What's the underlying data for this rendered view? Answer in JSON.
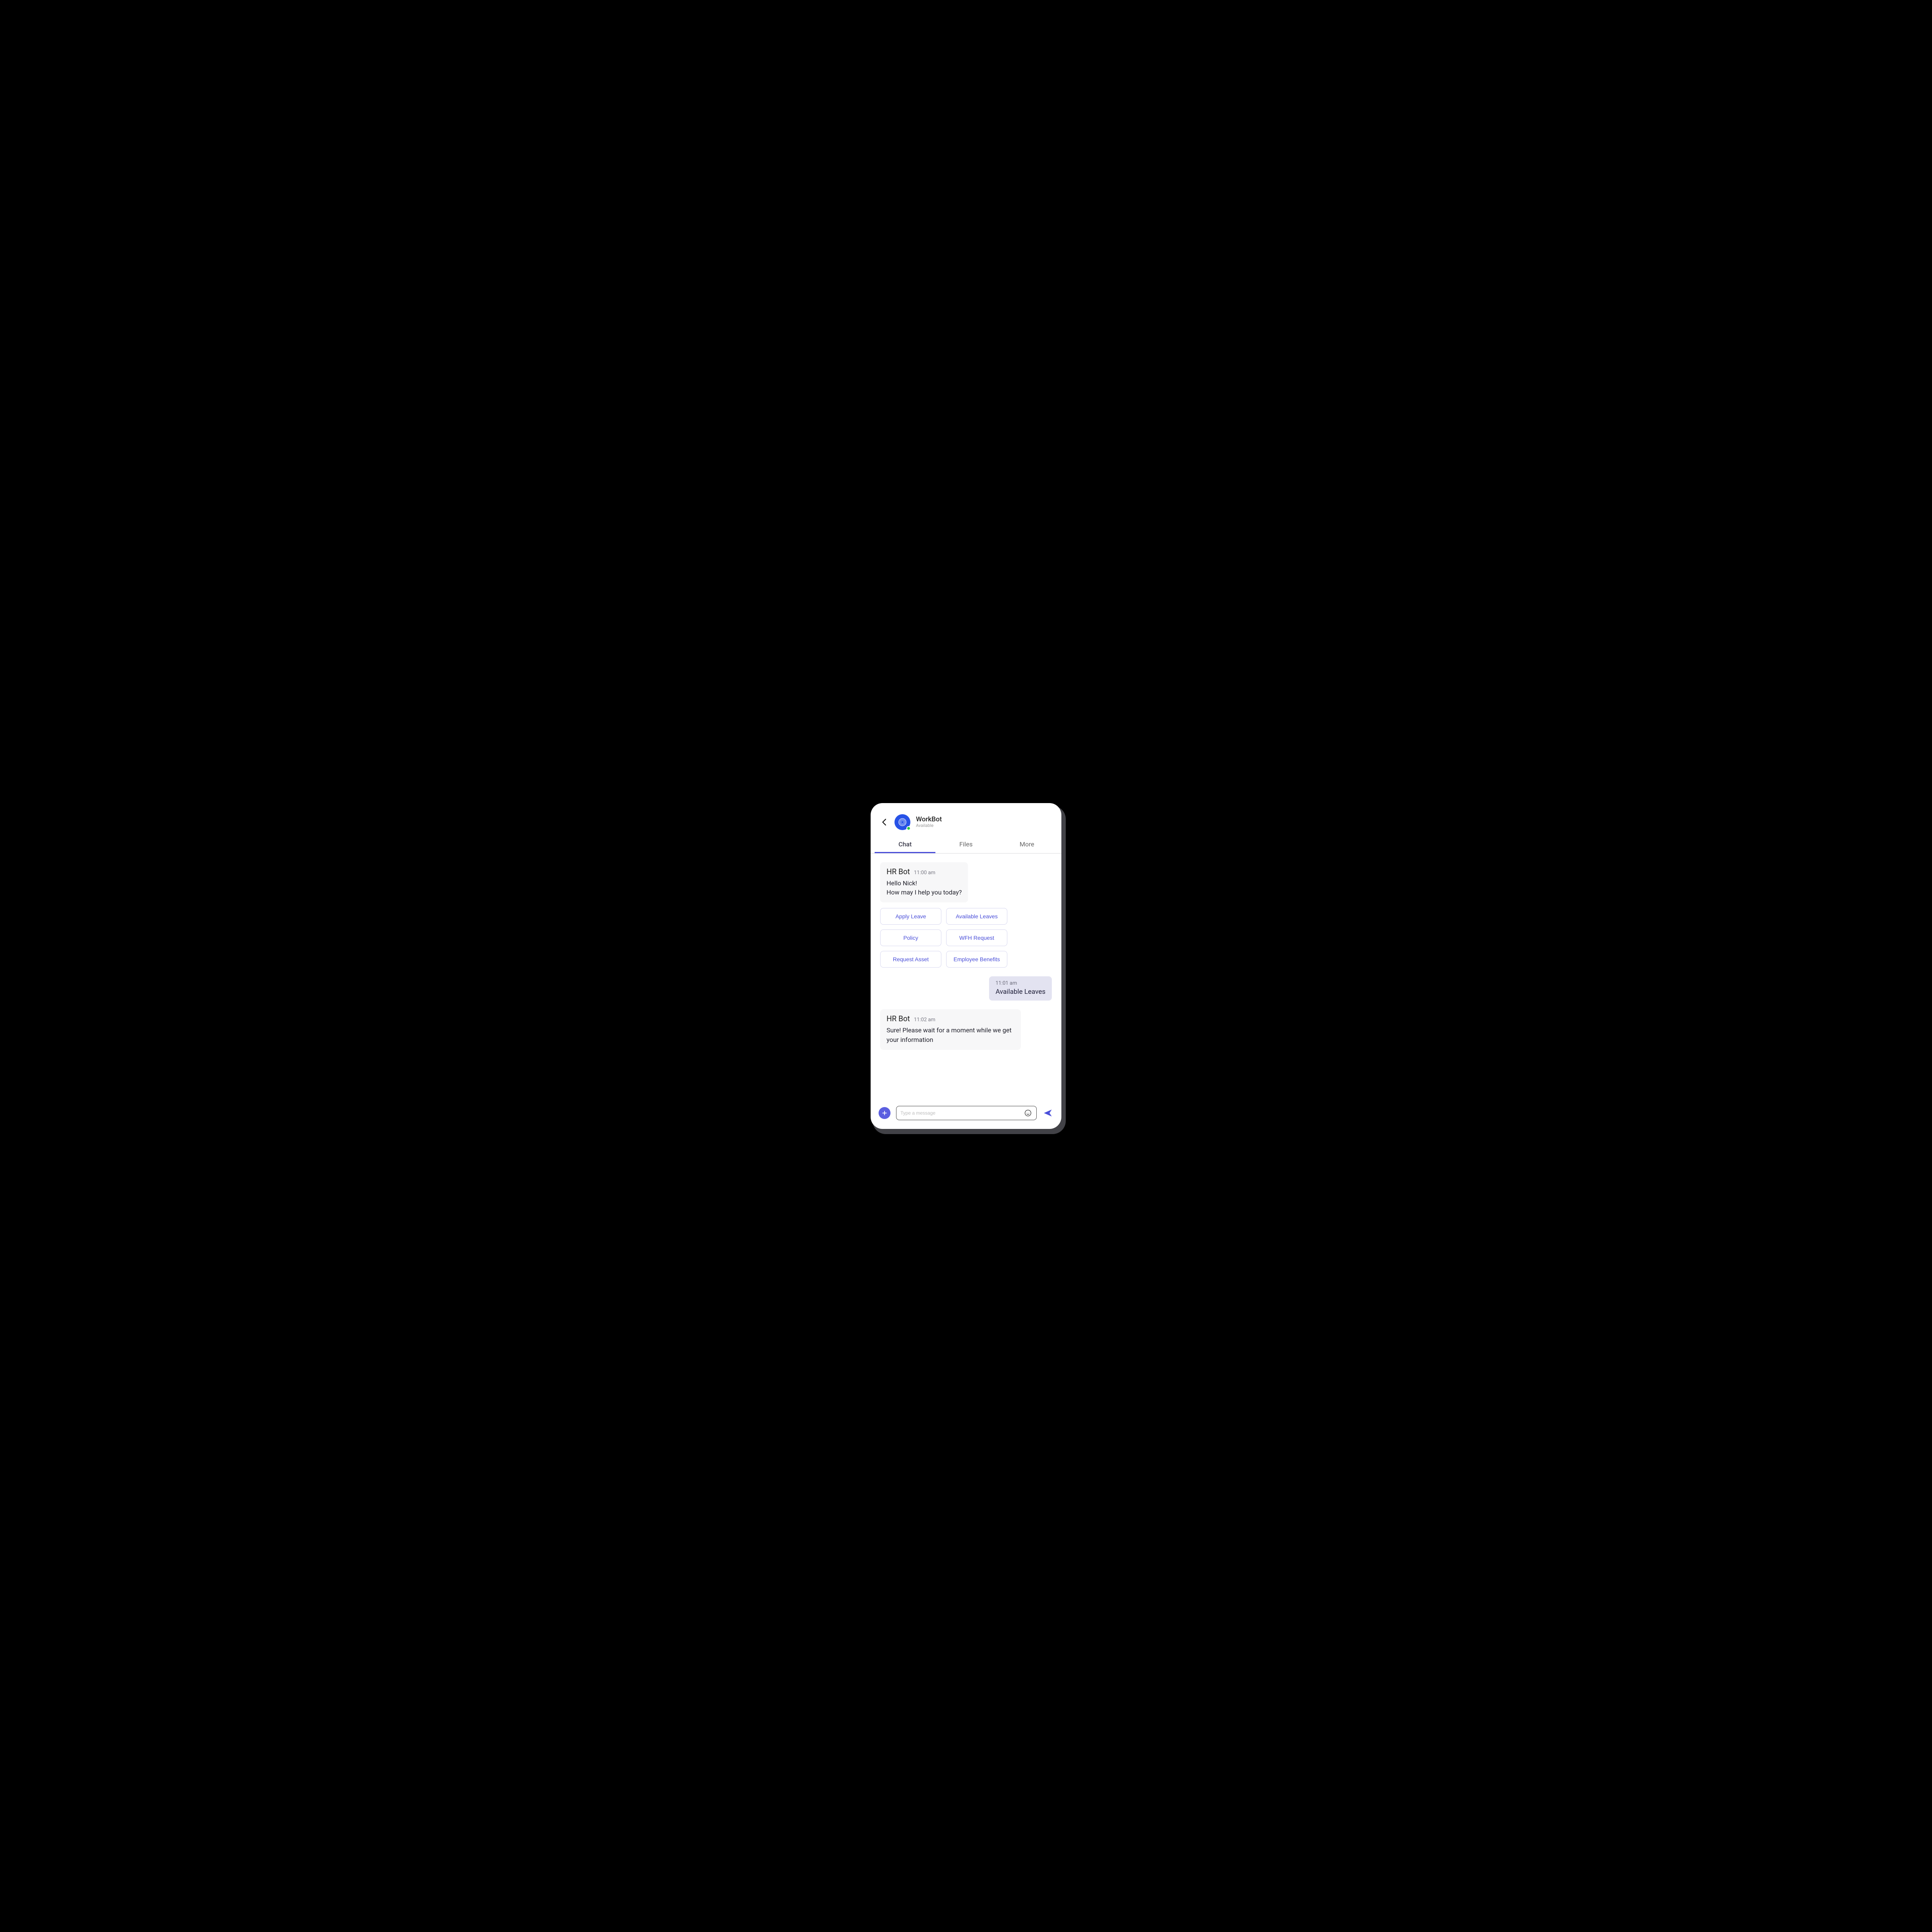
{
  "header": {
    "title": "WorkBot",
    "status": "Available"
  },
  "tabs": {
    "chat": "Chat",
    "files": "Files",
    "more": "More"
  },
  "messages": {
    "m0": {
      "sender": "HR Bot",
      "time": "11:00 am",
      "body": "Hello Nick!\nHow may I help you today?"
    },
    "m1": {
      "time": "11:01 am",
      "body": "Available Leaves"
    },
    "m2": {
      "sender": "HR Bot",
      "time": "11:02 am",
      "body": "Sure! Please wait for a moment while we get your information"
    }
  },
  "quick_replies": {
    "q0": "Apply Leave",
    "q1": "Available Leaves",
    "q2": "Policy",
    "q3": "WFH Request",
    "q4": "Request Asset",
    "q5": "Employee Benefits"
  },
  "composer": {
    "placeholder": "Type a message"
  },
  "colors": {
    "accent": "#4a4fd9",
    "avatar": "#2752e7",
    "user_bubble": "#e3e3f1",
    "bot_bubble": "#f7f7f8"
  }
}
